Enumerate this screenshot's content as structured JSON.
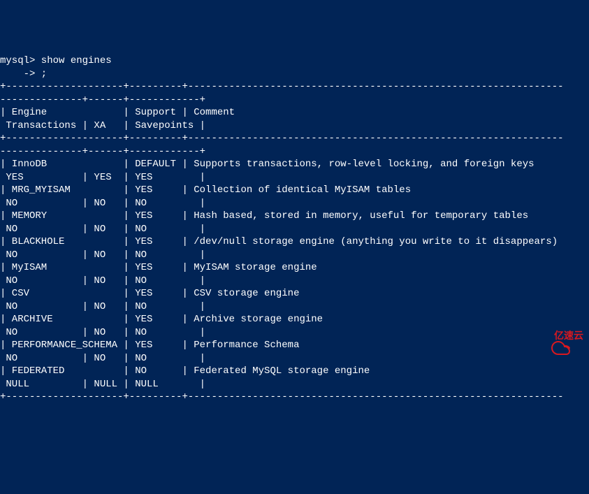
{
  "prompt": {
    "line1": "mysql> show engines",
    "line2": "    -> ;"
  },
  "divider1": "+--------------------+---------+----------------------------------------------------------------",
  "divider2": "--------------+------+------------+",
  "header": {
    "line1": "| Engine             | Support | Comment                                                        ",
    "line2": " Transactions | XA   | Savepoints |"
  },
  "engines": [
    {
      "line1": "| InnoDB             | DEFAULT | Supports transactions, row-level locking, and foreign keys     ",
      "line2": " YES          | YES  | YES        |"
    },
    {
      "line1": "| MRG_MYISAM         | YES     | Collection of identical MyISAM tables                          ",
      "line2": " NO           | NO   | NO         |"
    },
    {
      "line1": "| MEMORY             | YES     | Hash based, stored in memory, useful for temporary tables      ",
      "line2": " NO           | NO   | NO         |"
    },
    {
      "line1": "| BLACKHOLE          | YES     | /dev/null storage engine (anything you write to it disappears) ",
      "line2": " NO           | NO   | NO         |"
    },
    {
      "line1": "| MyISAM             | YES     | MyISAM storage engine                                          ",
      "line2": " NO           | NO   | NO         |"
    },
    {
      "line1": "| CSV                | YES     | CSV storage engine                                             ",
      "line2": " NO           | NO   | NO         |"
    },
    {
      "line1": "| ARCHIVE            | YES     | Archive storage engine                                         ",
      "line2": " NO           | NO   | NO         |"
    },
    {
      "line1": "| PERFORMANCE_SCHEMA | YES     | Performance Schema                                             ",
      "line2": " NO           | NO   | NO         |"
    },
    {
      "line1": "| FEDERATED          | NO      | Federated MySQL storage engine                                 ",
      "line2": " NULL         | NULL | NULL       |"
    }
  ],
  "watermark": {
    "text": "亿速云"
  }
}
